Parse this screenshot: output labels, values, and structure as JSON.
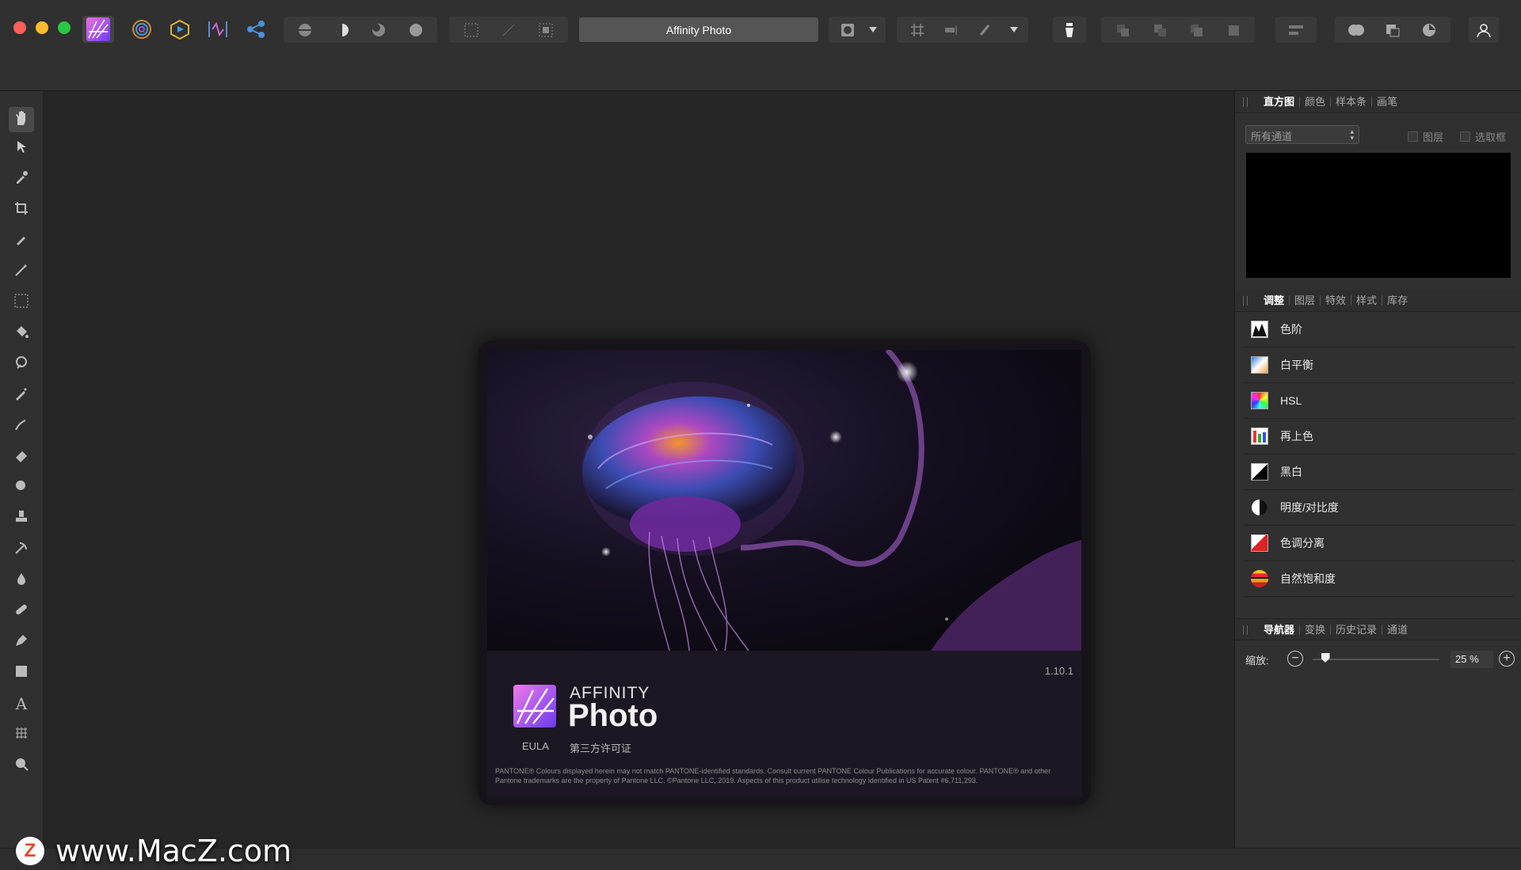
{
  "app": {
    "title": "Affinity Photo"
  },
  "colors": {
    "accent": "#a560ff",
    "close": "#fe5f57",
    "minimize": "#febc2e",
    "maximize": "#28c840"
  },
  "splash": {
    "version": "1.10.1",
    "brand_top": "AFFINITY",
    "brand_name": "Photo",
    "eula_label": "EULA",
    "third_party_label": "第三方许可证",
    "legal_text": "PANTONE® Colours displayed herein may not match PANTONE-identified standards. Consult current PANTONE Colour Publications for accurate colour. PANTONE® and other Pantone trademarks are the property of Pantone LLC. ©Pantone LLC, 2019. Aspects of this product utilise technology identified in US Patent #6,711,293."
  },
  "panels": {
    "histogram": {
      "tabs": [
        "直方图",
        "颜色",
        "样本条",
        "画笔"
      ],
      "channel_select": "所有通道",
      "layer_checkbox": "图层",
      "selection_checkbox": "选取框"
    },
    "adjustments": {
      "tabs": [
        "调整",
        "图层",
        "特效",
        "样式",
        "库存"
      ],
      "items": [
        {
          "label": "色阶",
          "icon": "levels-icon"
        },
        {
          "label": "白平衡",
          "icon": "white-balance-icon"
        },
        {
          "label": "HSL",
          "icon": "hsl-icon"
        },
        {
          "label": "再上色",
          "icon": "recolor-icon"
        },
        {
          "label": "黑白",
          "icon": "black-white-icon"
        },
        {
          "label": "明度/对比度",
          "icon": "brightness-contrast-icon"
        },
        {
          "label": "色调分离",
          "icon": "posterize-icon"
        },
        {
          "label": "自然饱和度",
          "icon": "vibrance-icon"
        }
      ]
    },
    "navigator": {
      "tabs": [
        "导航器",
        "变换",
        "历史记录",
        "通道"
      ],
      "zoom_label": "缩放:",
      "zoom_value": "25 %",
      "zoom_level": 0.1
    }
  },
  "watermark": {
    "logo_letter": "Z",
    "text": "www.MacZ.com"
  }
}
